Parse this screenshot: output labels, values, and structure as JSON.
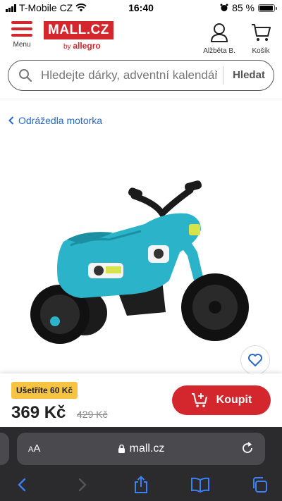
{
  "status_bar": {
    "carrier": "T-Mobile CZ",
    "time": "16:40",
    "battery": "85 %",
    "battery_level": 0.85
  },
  "header": {
    "menu_label": "Menu",
    "logo_text": "MALL.CZ",
    "logo_by": "by",
    "logo_partner": "allegro",
    "account_label": "Alžběta B.",
    "cart_label": "Košík"
  },
  "search": {
    "placeholder": "Hledejte dárky, adventní kalendáře",
    "button_label": "Hledat"
  },
  "breadcrumb": {
    "label": "Odrážedla motorka"
  },
  "product": {
    "icons": [
      "balance-bike-image",
      "heart-icon"
    ]
  },
  "pricing": {
    "savings_badge": "Ušetříte 60 Kč",
    "price": "369 Kč",
    "old_price": "429 Kč",
    "buy_label": "Koupit"
  },
  "browser": {
    "text_size_label_small": "A",
    "text_size_label_large": "A",
    "url": "mall.cz"
  },
  "colors": {
    "brand": "#d3262d",
    "link": "#2968c9",
    "badge": "#f6c342",
    "product_body": "#2bb3c9",
    "browser_chrome": "#2b2b2e",
    "browser_accent": "#3b82f6"
  }
}
